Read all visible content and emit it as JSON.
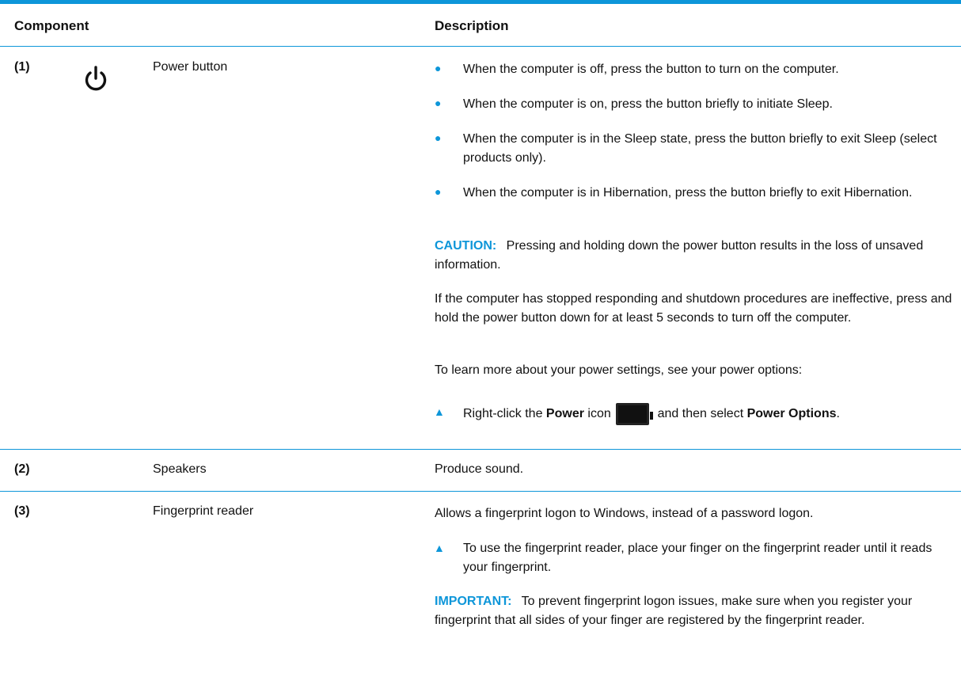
{
  "header": {
    "component": "Component",
    "description": "Description"
  },
  "rows": [
    {
      "num": "(1)",
      "icon": "power-icon",
      "name": "Power button",
      "bullets": [
        "When the computer is off, press the button to turn on the computer.",
        "When the computer is on, press the button briefly to initiate Sleep.",
        "When the computer is in the Sleep state, press the button briefly to exit Sleep (select products only).",
        "When the computer is in Hibernation, press the button briefly to exit Hibernation."
      ],
      "caution_label": "CAUTION:",
      "caution_text": "Pressing and holding down the power button results in the loss of unsaved information.",
      "para1": "If the computer has stopped responding and shutdown procedures are ineffective, press and hold the power button down for at least 5 seconds to turn off the computer.",
      "para2": "To learn more about your power settings, see your power options:",
      "step": {
        "pre": "Right-click the ",
        "bold1": "Power",
        "mid": " icon",
        "icon": "battery-icon",
        "post": ", and then select ",
        "bold2": "Power Options",
        "end": "."
      }
    },
    {
      "num": "(2)",
      "name": "Speakers",
      "desc": "Produce sound."
    },
    {
      "num": "(3)",
      "name": "Fingerprint reader",
      "desc": "Allows a fingerprint logon to Windows, instead of a password logon.",
      "step": "To use the fingerprint reader, place your finger on the fingerprint reader until it reads your fingerprint.",
      "important_label": "IMPORTANT:",
      "important_text": "To prevent fingerprint logon issues, make sure when you register your fingerprint that all sides of your finger are registered by the fingerprint reader."
    }
  ],
  "colors": {
    "accent": "#0d96d9",
    "text": "#111111"
  }
}
